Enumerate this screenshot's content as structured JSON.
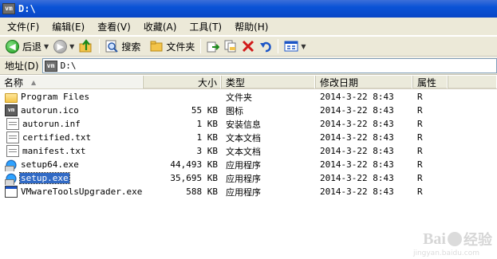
{
  "window": {
    "title": "D:\\",
    "logo": "vm"
  },
  "menu": [
    "文件(F)",
    "编辑(E)",
    "查看(V)",
    "收藏(A)",
    "工具(T)",
    "帮助(H)"
  ],
  "toolbar": {
    "back": "后退",
    "search": "搜索",
    "folders": "文件夹"
  },
  "address": {
    "label": "地址(D)",
    "value": "D:\\"
  },
  "columns": {
    "name": "名称",
    "size": "大小",
    "type": "类型",
    "date": "修改日期",
    "attr": "属性"
  },
  "files": [
    {
      "name": "Program Files",
      "size": "",
      "type": "文件夹",
      "date": "2014-3-22 8:43",
      "attr": "R",
      "icon": "folder-icon"
    },
    {
      "name": "autorun.ico",
      "size": "55 KB",
      "type": "图标",
      "date": "2014-3-22 8:43",
      "attr": "R",
      "icon": "vm-icon"
    },
    {
      "name": "autorun.inf",
      "size": "1 KB",
      "type": "安装信息",
      "date": "2014-3-22 8:43",
      "attr": "R",
      "icon": "settings-file-icon"
    },
    {
      "name": "certified.txt",
      "size": "1 KB",
      "type": "文本文档",
      "date": "2014-3-22 8:43",
      "attr": "R",
      "icon": "text-file-icon"
    },
    {
      "name": "manifest.txt",
      "size": "3 KB",
      "type": "文本文档",
      "date": "2014-3-22 8:43",
      "attr": "R",
      "icon": "text-file-icon"
    },
    {
      "name": "setup64.exe",
      "size": "44,493 KB",
      "type": "应用程序",
      "date": "2014-3-22 8:43",
      "attr": "R",
      "icon": "setup-icon"
    },
    {
      "name": "setup.exe",
      "size": "35,695 KB",
      "type": "应用程序",
      "date": "2014-3-22 8:43",
      "attr": "R",
      "icon": "setup-icon"
    },
    {
      "name": "VMwareToolsUpgrader.exe",
      "size": "588 KB",
      "type": "应用程序",
      "date": "2014-3-22 8:43",
      "attr": "R",
      "icon": "application-icon"
    }
  ],
  "watermark": {
    "brand_left": "Bai",
    "brand_right": "经验",
    "url": "jingyan.baidu.com"
  }
}
